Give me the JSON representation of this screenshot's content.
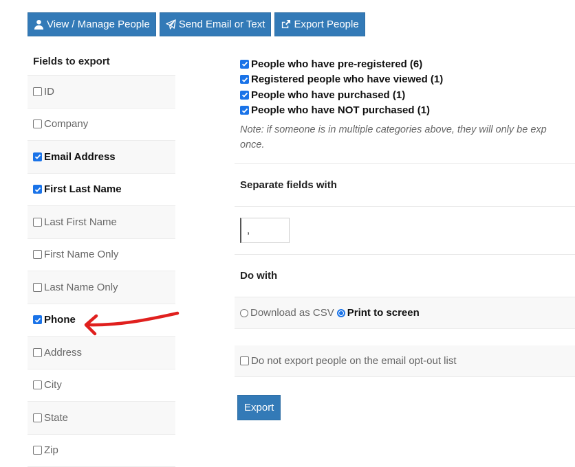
{
  "buttons": {
    "view_manage": "View / Manage People",
    "send_email": "Send Email or Text",
    "export_people": "Export People"
  },
  "fields": {
    "heading": "Fields to export",
    "items": [
      {
        "label": "ID",
        "checked": false
      },
      {
        "label": "Company",
        "checked": false
      },
      {
        "label": "Email Address",
        "checked": true
      },
      {
        "label": "First Last Name",
        "checked": true
      },
      {
        "label": "Last First Name",
        "checked": false
      },
      {
        "label": "First Name Only",
        "checked": false
      },
      {
        "label": "Last Name Only",
        "checked": false
      },
      {
        "label": "Phone",
        "checked": true
      },
      {
        "label": "Address",
        "checked": false
      },
      {
        "label": "City",
        "checked": false
      },
      {
        "label": "State",
        "checked": false
      },
      {
        "label": "Zip",
        "checked": false
      }
    ]
  },
  "categories": [
    "People who have pre-registered (6)",
    "Registered people who have viewed (1)",
    "People who have purchased (1)",
    "People who have NOT purchased (1)"
  ],
  "note": "Note: if someone is in multiple categories above, they will only be exported once.",
  "separator": {
    "heading": "Separate fields with",
    "value": ","
  },
  "do_with": {
    "heading": "Do with",
    "option_csv": "Download as CSV",
    "option_print": "Print to screen"
  },
  "opt_out_label": "Do not export people on the email opt-out list",
  "export_label": "Export",
  "colors": {
    "primary": "#337ab7",
    "check": "#1a73e8",
    "arrow": "#e0201e"
  }
}
